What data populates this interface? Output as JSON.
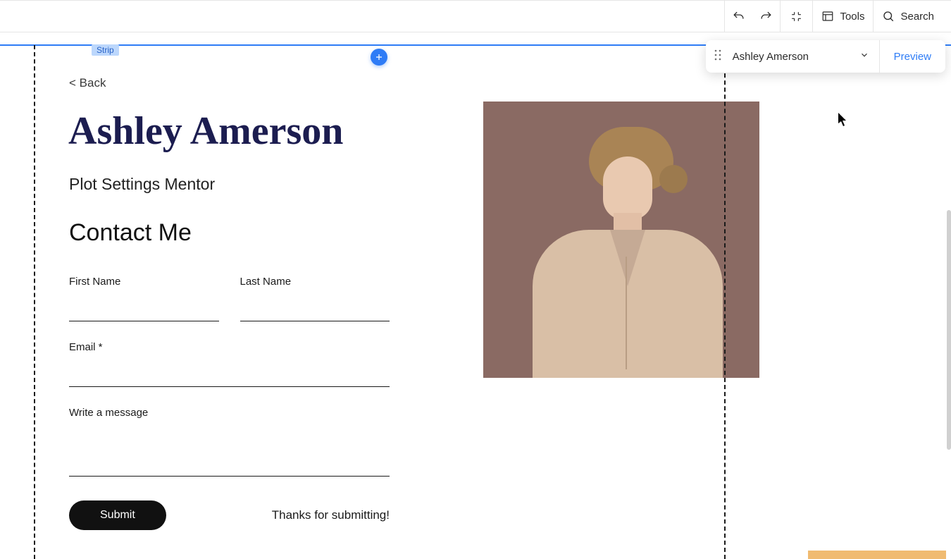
{
  "toolbar": {
    "tools_label": "Tools",
    "search_label": "Search"
  },
  "page_selector": {
    "current": "Ashley Amerson",
    "preview_label": "Preview"
  },
  "strip_tag": "Strip",
  "back_link": "< Back",
  "page_title": "Ashley Amerson",
  "subtitle": "Plot Settings Mentor",
  "contact_heading": "Contact Me",
  "form": {
    "first_name_label": "First Name",
    "last_name_label": "Last Name",
    "email_label": "Email *",
    "message_label": "Write a message",
    "submit_label": "Submit",
    "thanks": "Thanks for submitting!"
  }
}
